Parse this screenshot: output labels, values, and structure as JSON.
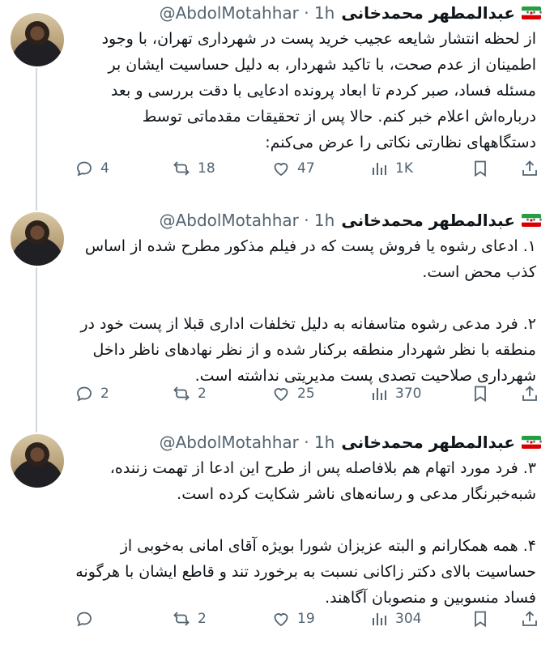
{
  "tweets": [
    {
      "name": "عبدالمطهر محمدخانی",
      "handle": "@AbdolMotahhar · 1h",
      "body": "از لحظه انتشار شایعه عجیب خرید پست در شهرداری تهران، با وجود اطمینان از عدم صحت، با تاکید شهردار، به دلیل حساسیت ایشان بر مسئله فساد، صبر کردم تا ابعاد پرونده ادعایی با دقت بررسی و بعد درباره‌اش اعلام خبر کنم. حالا پس از تحقیقات مقدماتی توسط دستگاههای نظارتی نکاتی را عرض می‌کنم:",
      "replies": "4",
      "retweets": "18",
      "likes": "47",
      "views": "1K"
    },
    {
      "name": "عبدالمطهر محمدخانی",
      "handle": "@AbdolMotahhar · 1h",
      "body": "۱. ادعای رشوه یا فروش پست که در فیلم مذکور مطرح شده از اساس کذب محض است.\n\n۲. فرد مدعی رشوه متاسفانه به دلیل تخلفات اداری قبلا از پست خود در منطقه با نظر شهردار منطقه برکنار شده و از نظر نهادهای ناظر داخل شهرداری صلاحیت تصدی پست مدیریتی نداشته است.",
      "replies": "2",
      "retweets": "2",
      "likes": "25",
      "views": "370"
    },
    {
      "name": "عبدالمطهر محمدخانی",
      "handle": "@AbdolMotahhar · 1h",
      "body": "۳. فرد مورد اتهام هم بلافاصله پس از طرح این ادعا از تهمت زننده، شبه‌خبرنگار مدعی و رسانه‌های ناشر شکایت کرده است.\n\n۴. همه همکارانم و البته عزیزان شورا بویژه آقای امانی به‌خوبی از حساسیت بالای دکتر زاکانی نسبت به برخورد تند و قاطع ایشان با هرگونه فساد منسوبین و منصوبان آگاهند.",
      "replies": "",
      "retweets": "2",
      "likes": "19",
      "views": "304"
    }
  ],
  "icons": {
    "reply": "reply-icon",
    "retweet": "retweet-icon",
    "like": "heart-icon",
    "views": "views-chart-icon",
    "bookmark": "bookmark-icon",
    "share": "share-icon",
    "more": "more-icon"
  },
  "colors": {
    "text": "#0f1419",
    "muted": "#536471",
    "line": "#cfd9de"
  },
  "more_label": "···"
}
